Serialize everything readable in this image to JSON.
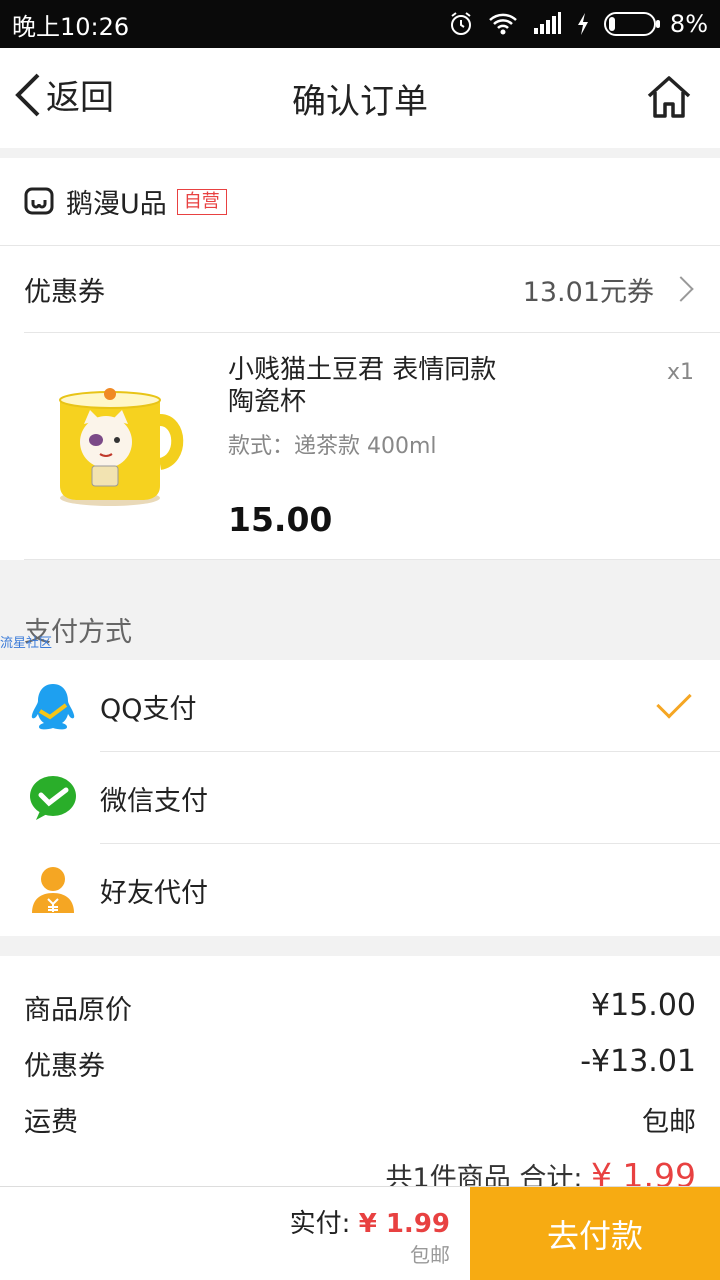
{
  "status_bar": {
    "time": "晚上10:26",
    "battery": "8%",
    "battery_level": 0.08
  },
  "nav": {
    "back_label": "返回",
    "title": "确认订单"
  },
  "shop": {
    "name": "鹅漫U品",
    "badge": "自营"
  },
  "coupon": {
    "label": "优惠券",
    "value": "13.01元券"
  },
  "product": {
    "name": "小贱猫土豆君 表情同款 陶瓷杯",
    "spec": "款式：递茶款 400ml",
    "qty": "x1",
    "price": "15.00"
  },
  "payment": {
    "title": "支付方式",
    "watermark": "流星社区",
    "options": [
      {
        "label": "QQ支付",
        "icon": "qq-penguin-icon",
        "selected": true
      },
      {
        "label": "微信支付",
        "icon": "wechat-icon",
        "selected": false
      },
      {
        "label": "好友代付",
        "icon": "friend-pay-icon",
        "selected": false
      }
    ]
  },
  "summary": {
    "rows": [
      {
        "label": "商品原价",
        "value": "¥15.00"
      },
      {
        "label": "优惠券",
        "value": "-¥13.01"
      },
      {
        "label": "运费",
        "value": "包邮"
      }
    ],
    "count_text": "共1件商品",
    "total_label": "合计:",
    "total_value": "¥ 1.99"
  },
  "bottom": {
    "pay_label": "实付:",
    "pay_value": "¥ 1.99",
    "shipping": "包邮",
    "button": "去付款"
  },
  "colors": {
    "accent": "#f7ab12",
    "price_red": "#e84141",
    "qq_blue": "#1ea0f0",
    "wechat_green": "#2aae2a",
    "friend_orange": "#f5a623"
  }
}
